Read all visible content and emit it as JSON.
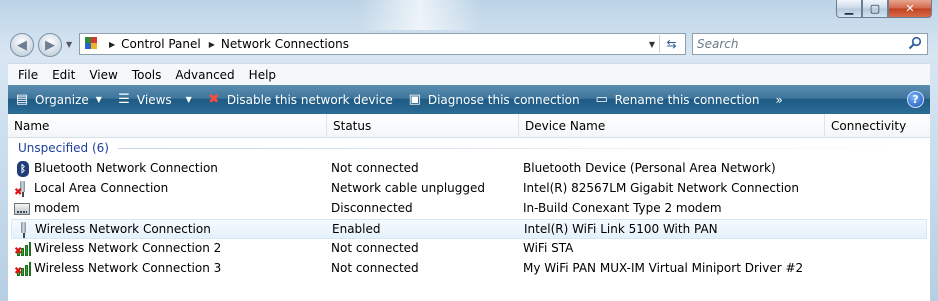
{
  "window": {
    "caption_buttons": {
      "minimize": "▁",
      "maximize": "▢",
      "close": "✕"
    }
  },
  "address": {
    "crumbs": [
      "Control Panel",
      "Network Connections"
    ],
    "search_placeholder": "Search"
  },
  "menu": {
    "items": [
      "File",
      "Edit",
      "View",
      "Tools",
      "Advanced",
      "Help"
    ]
  },
  "commands": {
    "organize": "Organize",
    "views": "Views",
    "disable": "Disable this network device",
    "diagnose": "Diagnose this connection",
    "rename": "Rename this connection",
    "more": "»",
    "help": "?"
  },
  "list": {
    "columns": [
      "Name",
      "Status",
      "Device Name",
      "Connectivity"
    ],
    "group": "Unspecified (6)",
    "rows": [
      {
        "icon": "bluetooth-icon",
        "name": "Bluetooth Network Connection",
        "status": "Not connected",
        "device": "Bluetooth Device (Personal Area Network)"
      },
      {
        "icon": "ethernet-plug-icon",
        "name": "Local Area Connection",
        "status": "Network cable unplugged",
        "device": "Intel(R) 82567LM Gigabit Network Connection"
      },
      {
        "icon": "modem-icon",
        "name": "modem",
        "status": "Disconnected",
        "device": "In-Build Conexant Type 2 modem"
      },
      {
        "icon": "wireless-adapter-icon",
        "name": "Wireless Network Connection",
        "status": "Enabled",
        "device": "Intel(R) WiFi Link 5100 With PAN"
      },
      {
        "icon": "wireless-signal-icon",
        "name": "Wireless Network Connection 2",
        "status": "Not connected",
        "device": "WiFi STA"
      },
      {
        "icon": "wireless-signal-icon",
        "name": "Wireless Network Connection 3",
        "status": "Not connected",
        "device": "My WiFi PAN MUX-IM Virtual Miniport Driver #2"
      }
    ],
    "selected_index": 3
  }
}
